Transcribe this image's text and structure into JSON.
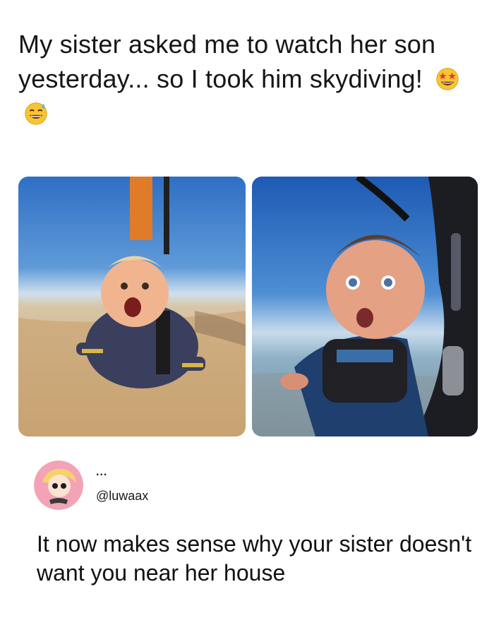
{
  "post": {
    "text": "My sister asked me to watch her son yesterday... so I took him skydiving!",
    "emojis": [
      "star-struck-emoji",
      "grinning-sweat-emoji"
    ]
  },
  "images": [
    {
      "name": "baby-skydiving-photo-1"
    },
    {
      "name": "baby-skydiving-photo-2"
    }
  ],
  "reply": {
    "display_name": "...",
    "handle": "@luwaax",
    "text": "It now makes sense why your sister doesn't want you near her house"
  },
  "colors": {
    "sky_blue": "#3d7fd0",
    "ground_tan": "#c9a77a",
    "avatar_pink": "#f4a3b6",
    "emoji_yellow": "#f7c531"
  }
}
